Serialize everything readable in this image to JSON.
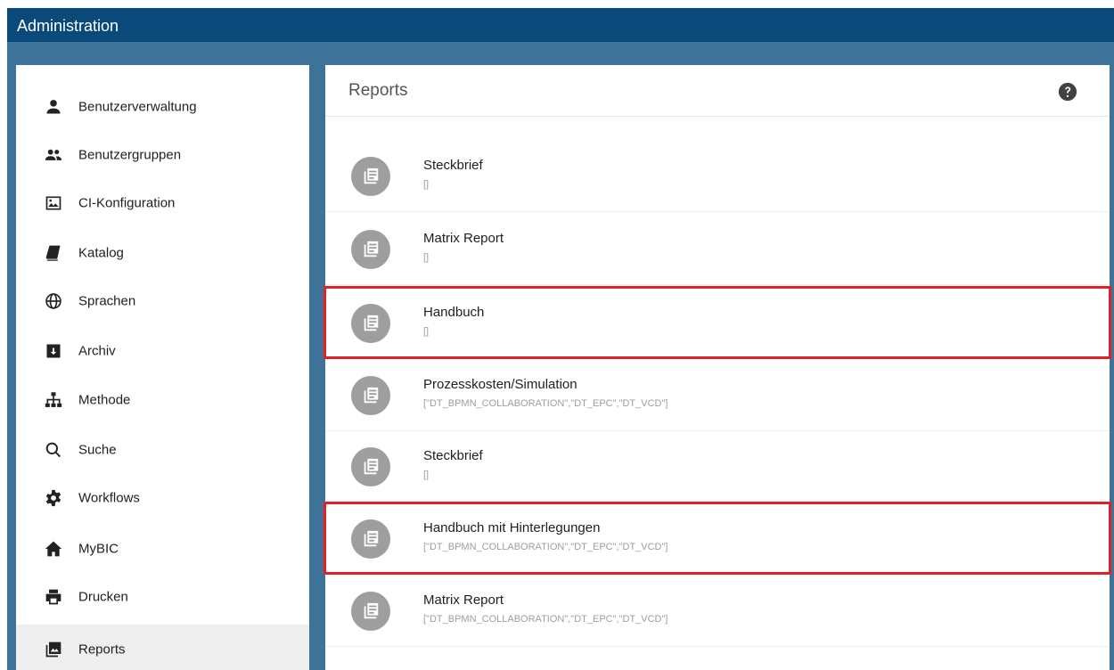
{
  "app": {
    "title": "Administration"
  },
  "sidebar": {
    "items": [
      {
        "label": "Benutzerverwaltung",
        "icon": "person-icon"
      },
      {
        "label": "Benutzergruppen",
        "icon": "people-icon"
      },
      {
        "label": "CI-Konfiguration",
        "icon": "image-icon"
      },
      {
        "label": "Katalog",
        "icon": "book-icon"
      },
      {
        "label": "Sprachen",
        "icon": "globe-icon"
      },
      {
        "label": "Archiv",
        "icon": "archive-icon"
      },
      {
        "label": "Methode",
        "icon": "sitemap-icon"
      },
      {
        "label": "Suche",
        "icon": "search-icon"
      },
      {
        "label": "Workflows",
        "icon": "gear-icon"
      },
      {
        "label": "MyBIC",
        "icon": "home-icon"
      },
      {
        "label": "Drucken",
        "icon": "print-icon"
      },
      {
        "label": "Reports",
        "icon": "photo-library-icon",
        "active": true
      }
    ]
  },
  "panel": {
    "title": "Reports",
    "help_icon": "help-icon"
  },
  "reports": [
    {
      "title": "Steckbrief",
      "subtitle": "[]"
    },
    {
      "title": "Matrix Report",
      "subtitle": "[]"
    },
    {
      "title": "Handbuch",
      "subtitle": "[]",
      "highlighted": true
    },
    {
      "title": "Prozesskosten/Simulation",
      "subtitle": "[\"DT_BPMN_COLLABORATION\",\"DT_EPC\",\"DT_VCD\"]"
    },
    {
      "title": "Steckbrief",
      "subtitle": "[]"
    },
    {
      "title": "Handbuch mit Hinterlegungen",
      "subtitle": "[\"DT_BPMN_COLLABORATION\",\"DT_EPC\",\"DT_VCD\"]",
      "highlighted": true
    },
    {
      "title": "Matrix Report",
      "subtitle": "[\"DT_BPMN_COLLABORATION\",\"DT_EPC\",\"DT_VCD\"]"
    }
  ],
  "colors": {
    "topbar": "#0a4a7a",
    "background": "#3d7398",
    "highlight": "#e32025",
    "avatar": "#9e9e9e"
  }
}
